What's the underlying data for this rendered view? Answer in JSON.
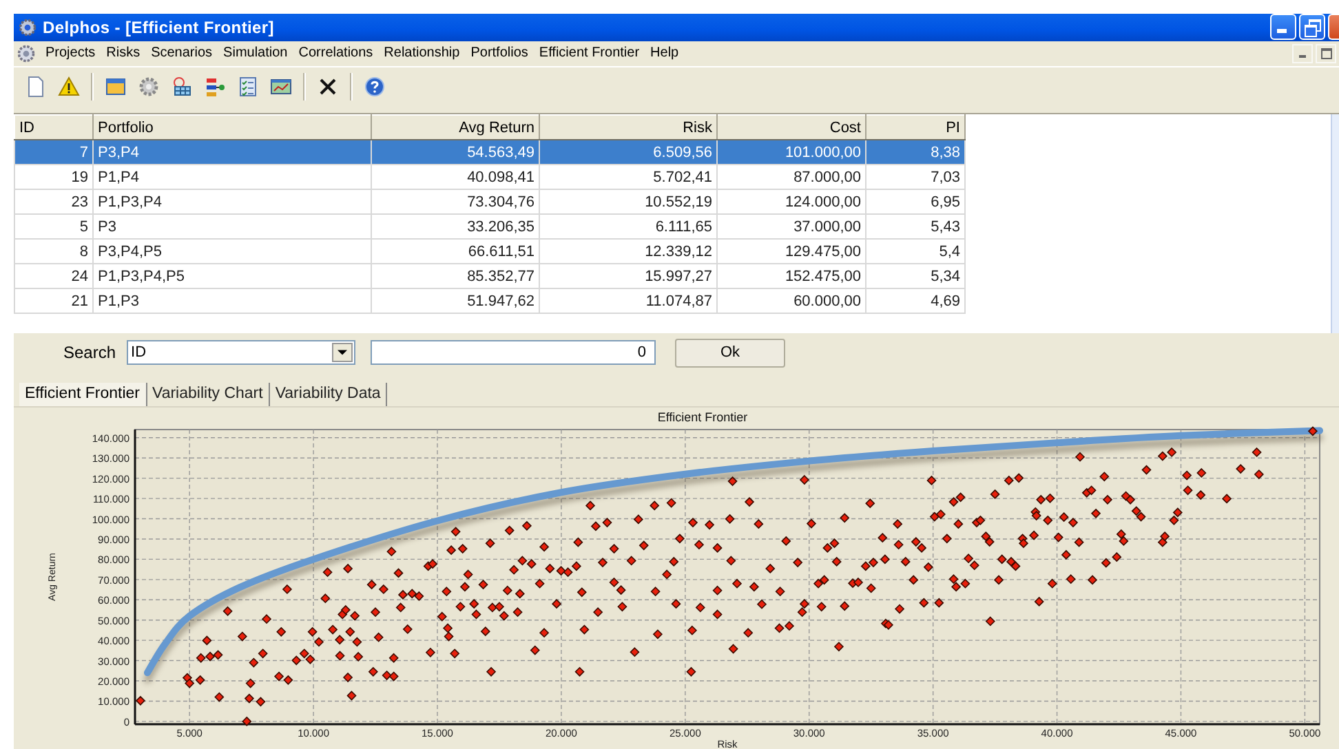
{
  "window": {
    "title": "Delphos - [Efficient Frontier]"
  },
  "menu": [
    "Projects",
    "Risks",
    "Scenarios",
    "Simulation",
    "Correlations",
    "Relationship",
    "Portfolios",
    "Efficient Frontier",
    "Help"
  ],
  "table": {
    "columns": [
      "ID",
      "Portfolio",
      "Avg Return",
      "Risk",
      "Cost",
      "PI"
    ],
    "rows": [
      {
        "cells": [
          "7",
          "P3,P4",
          "54.563,49",
          "6.509,56",
          "101.000,00",
          "8,38"
        ],
        "selected": true
      },
      {
        "cells": [
          "19",
          "P1,P4",
          "40.098,41",
          "5.702,41",
          "87.000,00",
          "7,03"
        ],
        "selected": false
      },
      {
        "cells": [
          "23",
          "P1,P3,P4",
          "73.304,76",
          "10.552,19",
          "124.000,00",
          "6,95"
        ],
        "selected": false
      },
      {
        "cells": [
          "5",
          "P3",
          "33.206,35",
          "6.111,65",
          "37.000,00",
          "5,43"
        ],
        "selected": false
      },
      {
        "cells": [
          "8",
          "P3,P4,P5",
          "66.611,51",
          "12.339,12",
          "129.475,00",
          "5,4"
        ],
        "selected": false
      },
      {
        "cells": [
          "24",
          "P1,P3,P4,P5",
          "85.352,77",
          "15.997,27",
          "152.475,00",
          "5,34"
        ],
        "selected": false
      },
      {
        "cells": [
          "21",
          "P1,P3",
          "51.947,62",
          "11.074,87",
          "60.000,00",
          "4,69"
        ],
        "selected": false
      }
    ]
  },
  "search": {
    "label": "Search",
    "field": "ID",
    "value": "0",
    "button": "Ok"
  },
  "tabs": [
    {
      "label": "Efficient Frontier",
      "selected": true
    },
    {
      "label": "Variability Chart",
      "selected": false
    },
    {
      "label": "Variability Data",
      "selected": false
    }
  ],
  "chart": {
    "chart_data": {
      "type": "scatter",
      "title": "Efficient Frontier",
      "xlabel": "Risk",
      "ylabel": "Avg Return",
      "xlim": [
        2800,
        50600
      ],
      "ylim": [
        -1400,
        144000
      ],
      "grid": true,
      "xticks": [
        {
          "value": 5000,
          "label": "5.000"
        },
        {
          "value": 10000,
          "label": "10.000"
        },
        {
          "value": 15000,
          "label": "15.000"
        },
        {
          "value": 20000,
          "label": "20.000"
        },
        {
          "value": 25000,
          "label": "25.000"
        },
        {
          "value": 30000,
          "label": "30.000"
        },
        {
          "value": 35000,
          "label": "35.000"
        },
        {
          "value": 40000,
          "label": "40.000"
        },
        {
          "value": 45000,
          "label": "45.000"
        },
        {
          "value": 50000,
          "label": "50.000"
        }
      ],
      "yticks": [
        {
          "value": 0,
          "label": "0"
        },
        {
          "value": 10000,
          "label": "10.000"
        },
        {
          "value": 20000,
          "label": "20.000"
        },
        {
          "value": 30000,
          "label": "30.000"
        },
        {
          "value": 40000,
          "label": "40.000"
        },
        {
          "value": 50000,
          "label": "50.000"
        },
        {
          "value": 60000,
          "label": "60.000"
        },
        {
          "value": 70000,
          "label": "70.000"
        },
        {
          "value": 80000,
          "label": "80.000"
        },
        {
          "value": 90000,
          "label": "90.000"
        },
        {
          "value": 100000,
          "label": "100.000"
        },
        {
          "value": 110000,
          "label": "110.000"
        },
        {
          "value": 120000,
          "label": "120.000"
        },
        {
          "value": 130000,
          "label": "130.000"
        },
        {
          "value": 140000,
          "label": "140.000"
        }
      ],
      "x": [
        3300,
        4000,
        5000,
        7000,
        10000,
        15000,
        20000,
        25000,
        30000,
        35000,
        40000,
        45000,
        50600,
        3020,
        4910,
        5000,
        5430,
        5460,
        5700,
        5830,
        6150,
        6200,
        6540,
        7130,
        7310,
        7410,
        7460,
        7590,
        7870,
        7960,
        8110,
        8610,
        8700,
        8940,
        8980,
        9310,
        9630,
        9870,
        9960,
        10220,
        10480,
        10570,
        10780,
        11060,
        11070,
        11170,
        11300,
        11390,
        11390,
        11540,
        11480,
        11670,
        11760,
        11810,
        12350,
        12410,
        12500,
        12630,
        12830,
        12960,
        13150,
        13240,
        13240,
        13430,
        13520,
        13610,
        13800,
        13980,
        14260,
        14630,
        14720,
        14810,
        15190,
        15370,
        15420,
        15460,
        15560,
        15700,
        15740,
        16020,
        16110,
        15930,
        16240,
        16480,
        16570,
        16850,
        16940,
        17130,
        17170,
        17220,
        17500,
        17690,
        17830,
        17910,
        18090,
        18240,
        18330,
        18430,
        18610,
        18800,
        18940,
        19130,
        19310,
        19310,
        19540,
        19810,
        19990,
        20270,
        20610,
        20680,
        20740,
        20830,
        20930,
        21170,
        21390,
        21480,
        21670,
        21850,
        22130,
        22130,
        22410,
        22460,
        22830,
        22960,
        23110,
        23330,
        23760,
        23800,
        23890,
        24260,
        24440,
        24540,
        24630,
        24780,
        26910,
        25310,
        25560,
        25980,
        26300,
        26300,
        26850,
        26800,
        27090,
        27590,
        27780,
        27960,
        28090,
        28430,
        28830,
        29070,
        28800,
        29200,
        27540,
        26940,
        25280,
        25240,
        25610,
        26300,
        29540,
        29810,
        29810,
        29720,
        30090,
        30370,
        30500,
        30610,
        30740,
        31020,
        31110,
        31200,
        31430,
        31430,
        31760,
        31980,
        32280,
        32460,
        32500,
        32590,
        32960,
        33060,
        33090,
        33200,
        33570,
        33610,
        33650,
        33890,
        34210,
        34310,
        34540,
        34630,
        34810,
        34940,
        35060,
        35240,
        35310,
        35560,
        35830,
        35830,
        35930,
        36020,
        36110,
        36300,
        36430,
        36670,
        36760,
        36910,
        37130,
        37310,
        37280,
        37500,
        37650,
        37780,
        38060,
        38150,
        38330,
        38460,
        38610,
        38650,
        39070,
        39130,
        39170,
        39280,
        39350,
        39630,
        39720,
        39810,
        40060,
        40280,
        40370,
        40560,
        40650,
        40890,
        40930,
        41200,
        41390,
        41430,
        41570,
        41910,
        41980,
        42040,
        42410,
        42590,
        42690,
        42780,
        42960,
        43200,
        43390,
        43610,
        44260,
        44350,
        44260,
        44630,
        44720,
        44870,
        45240,
        45280,
        45830,
        45800,
        46850,
        47410,
        48060,
        48150,
        50320
      ],
      "series": [
        {
          "type": "line",
          "color": "#6699d0",
          "values": [
            24000,
            38000,
            52000,
            66000,
            80000,
            99000,
            113000,
            122000,
            128500,
            133500,
            137500,
            141000,
            143500,
            null,
            null,
            null,
            null,
            null,
            null,
            null,
            null,
            null,
            null,
            null,
            null,
            null,
            null,
            null,
            null,
            null,
            null,
            null,
            null,
            null,
            null,
            null,
            null,
            null,
            null,
            null,
            null,
            null,
            null,
            null,
            null,
            null,
            null,
            null,
            null,
            null,
            null,
            null,
            null,
            null,
            null,
            null,
            null,
            null,
            null,
            null,
            null,
            null,
            null,
            null,
            null,
            null,
            null,
            null,
            null,
            null,
            null,
            null,
            null,
            null,
            null,
            null,
            null,
            null,
            null,
            null,
            null,
            null,
            null,
            null,
            null,
            null,
            null,
            null,
            null,
            null,
            null,
            null,
            null,
            null,
            null,
            null,
            null,
            null,
            null,
            null,
            null,
            null,
            null,
            null,
            null,
            null,
            null,
            null,
            null,
            null,
            null,
            null,
            null,
            null,
            null,
            null,
            null,
            null,
            null,
            null,
            null,
            null,
            null,
            null,
            null,
            null,
            null,
            null,
            null,
            null,
            null,
            null,
            null,
            null,
            null,
            null,
            null,
            null,
            null,
            null,
            null,
            null,
            null,
            null,
            null,
            null,
            null,
            null,
            null,
            null,
            null,
            null,
            null,
            null,
            null,
            null,
            null,
            null,
            null,
            null,
            null,
            null,
            null,
            null,
            null,
            null,
            null,
            null,
            null,
            null,
            null,
            null,
            null,
            null,
            null,
            null,
            null,
            null,
            null,
            null,
            null,
            null,
            null,
            null,
            null,
            null,
            null,
            null,
            null,
            null,
            null,
            null,
            null,
            null,
            null,
            null,
            null,
            null,
            null,
            null,
            null,
            null,
            null,
            null,
            null,
            null,
            null,
            null,
            null,
            null,
            null,
            null,
            null,
            null,
            null,
            null,
            null,
            null,
            null,
            null,
            null,
            null,
            null,
            null,
            null,
            null,
            null,
            null,
            null,
            null,
            null,
            null,
            null,
            null,
            null,
            null,
            null,
            null,
            null,
            null,
            null,
            null,
            null,
            null,
            null,
            null,
            null,
            null,
            null,
            null,
            null,
            null,
            null,
            null,
            null,
            null,
            null,
            null,
            null,
            null,
            null,
            null,
            null
          ]
        },
        {
          "type": "scatter",
          "color": "#e8200c",
          "values": [
            null,
            null,
            null,
            null,
            null,
            null,
            null,
            null,
            null,
            null,
            null,
            null,
            null,
            10200,
            21500,
            18800,
            20400,
            31300,
            39900,
            32000,
            32800,
            12000,
            54400,
            41900,
            0,
            11300,
            18800,
            29000,
            9700,
            33500,
            50500,
            22200,
            44200,
            65200,
            20400,
            30100,
            33500,
            30600,
            44200,
            39200,
            60700,
            73600,
            45300,
            40300,
            32400,
            52800,
            55000,
            75400,
            21700,
            12700,
            44200,
            52100,
            39200,
            31900,
            67500,
            24500,
            53900,
            41500,
            65200,
            22700,
            83800,
            22200,
            31300,
            73200,
            56200,
            62500,
            45500,
            63000,
            61800,
            76600,
            34000,
            77700,
            51700,
            64100,
            46000,
            41900,
            84500,
            33500,
            93600,
            85200,
            66400,
            56600,
            72500,
            58000,
            52800,
            67500,
            44400,
            87900,
            24500,
            56200,
            56600,
            52100,
            64600,
            94200,
            74800,
            53900,
            63000,
            79300,
            96500,
            77700,
            35100,
            68000,
            86100,
            43700,
            75400,
            58000,
            74300,
            73600,
            76600,
            88400,
            24500,
            63700,
            45300,
            106500,
            96300,
            53900,
            78400,
            98100,
            85200,
            68600,
            64800,
            56600,
            79300,
            34200,
            99700,
            86800,
            106500,
            64100,
            43000,
            72500,
            107800,
            78800,
            58000,
            90200,
            118500,
            98100,
            87200,
            97000,
            85600,
            64600,
            79300,
            99900,
            68000,
            108300,
            66400,
            97400,
            57800,
            75400,
            64100,
            89000,
            46000,
            47100,
            43700,
            35800,
            44900,
            24500,
            56200,
            52800,
            78400,
            119200,
            58000,
            53900,
            97600,
            68000,
            56600,
            69800,
            85600,
            87900,
            78800,
            36900,
            100400,
            56900,
            68200,
            68600,
            76600,
            107600,
            65700,
            78400,
            90600,
            80000,
            48300,
            47600,
            97400,
            87200,
            55500,
            78800,
            69800,
            88600,
            85600,
            58500,
            76100,
            118900,
            101000,
            58500,
            102200,
            90200,
            108300,
            70200,
            66400,
            97400,
            110600,
            68000,
            80400,
            77000,
            98100,
            99200,
            91300,
            49400,
            88600,
            112100,
            69800,
            80000,
            118900,
            78800,
            76600,
            120100,
            90200,
            87900,
            91800,
            103300,
            101500,
            59100,
            109400,
            99200,
            110100,
            68000,
            90800,
            100800,
            82200,
            70200,
            98100,
            88400,
            130500,
            112800,
            114000,
            69800,
            102600,
            120800,
            78200,
            109400,
            81100,
            92400,
            89000,
            111200,
            109400,
            103800,
            101000,
            124100,
            88400,
            91300,
            130900,
            132800,
            99200,
            103100,
            121400,
            114000,
            122600,
            111700,
            109900,
            124600,
            132800,
            121900,
            143200
          ]
        }
      ]
    }
  }
}
